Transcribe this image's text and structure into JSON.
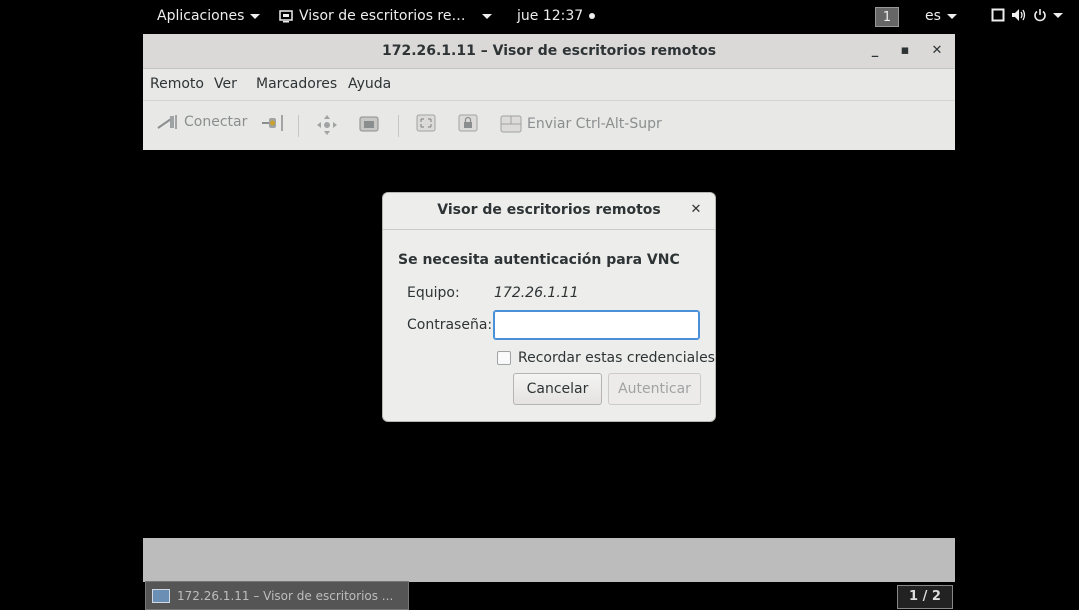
{
  "top_panel": {
    "apps_menu": "Aplicaciones",
    "active_app": "Visor de escritorios re…",
    "clock": "jue 12:37",
    "workspace": "1",
    "keyboard_layout": "es"
  },
  "window": {
    "title": "172.26.1.11 – Visor de escritorios remotos",
    "menu": [
      "Remoto",
      "Ver",
      "Marcadores",
      "Ayuda"
    ],
    "toolbar": {
      "connect_label": "Conectar",
      "send_keys_label": "Enviar Ctrl-Alt-Supr"
    }
  },
  "dialog": {
    "title": "Visor de escritorios remotos",
    "heading": "Se necesita autenticación para VNC",
    "host_label": "Equipo:",
    "host_value": "172.26.1.11",
    "password_label": "Contraseña:",
    "password_value": "",
    "remember_label": "Recordar estas credenciales",
    "remember_checked": false,
    "cancel_label": "Cancelar",
    "auth_label": "Autenticar"
  },
  "taskbar": {
    "item_label": "172.26.1.11 – Visor de escritorios ...",
    "pager": "1 / 2"
  },
  "colors": {
    "focus_blue": "#4a90d9",
    "panel_bg": "#000000",
    "window_bg": "#e8e8e7"
  }
}
